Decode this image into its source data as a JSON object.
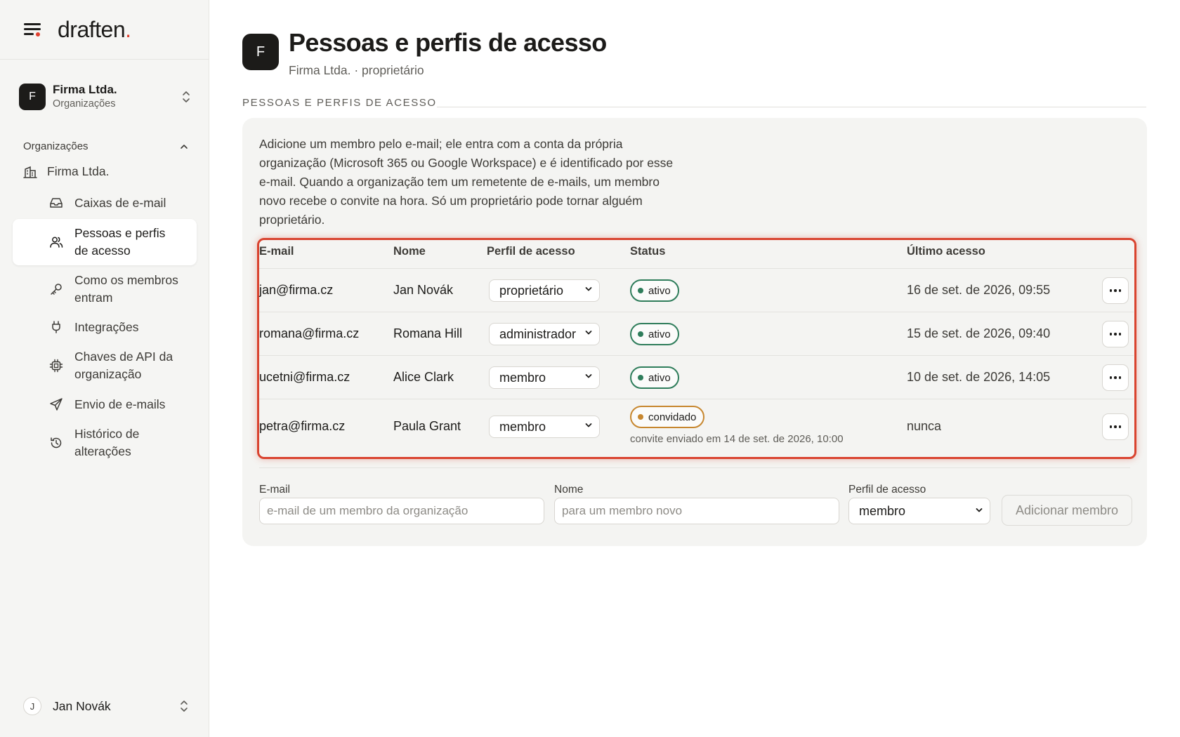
{
  "brand": {
    "name": "draften",
    "dot": "."
  },
  "org_switcher": {
    "initial": "F",
    "name": "Firma Ltda.",
    "sub": "Organizações"
  },
  "sidebar": {
    "section_title": "Organizações",
    "org_item": "Firma Ltda.",
    "items": [
      {
        "label": "Caixas de e-mail",
        "icon": "inbox-icon"
      },
      {
        "label": "Pessoas e perfis de acesso",
        "icon": "users-icon",
        "active": true
      },
      {
        "label": "Como os membros entram",
        "icon": "key-icon"
      },
      {
        "label": "Integrações",
        "icon": "plug-icon"
      },
      {
        "label": "Chaves de API da organização",
        "icon": "chip-icon"
      },
      {
        "label": "Envio de e-mails",
        "icon": "send-icon"
      },
      {
        "label": "Histórico de alterações",
        "icon": "history-icon"
      }
    ]
  },
  "user": {
    "initial": "J",
    "name": "Jan Novák"
  },
  "page": {
    "avatar_initial": "F",
    "title": "Pessoas e perfis de acesso",
    "subtitle": "Firma Ltda. · proprietário",
    "section_label": "PESSOAS E PERFIS DE ACESSO",
    "intro": "Adicione um membro pelo e-mail; ele entra com a conta da própria organização (Microsoft 365 ou Google Workspace) e é identificado por esse e-mail. Quando a organização tem um remetente de e-mails, um membro novo recebe o convite na hora. Só um proprietário pode tornar alguém proprietário."
  },
  "table": {
    "headers": {
      "email": "E-mail",
      "name": "Nome",
      "role": "Perfil de acesso",
      "status": "Status",
      "last": "Último acesso"
    },
    "rows": [
      {
        "email": "jan@firma.cz",
        "name": "Jan Novák",
        "role": "proprietário",
        "status": "ativo",
        "status_kind": "active",
        "last": "16 de set. de 2026, 09:55"
      },
      {
        "email": "romana@firma.cz",
        "name": "Romana Hill",
        "role": "administrador",
        "status": "ativo",
        "status_kind": "active",
        "last": "15 de set. de 2026, 09:40"
      },
      {
        "email": "ucetni@firma.cz",
        "name": "Alice Clark",
        "role": "membro",
        "status": "ativo",
        "status_kind": "active",
        "last": "10 de set. de 2026, 14:05"
      },
      {
        "email": "petra@firma.cz",
        "name": "Paula Grant",
        "role": "membro",
        "status": "convidado",
        "status_kind": "invited",
        "note": "convite enviado em 14 de set. de 2026, 10:00",
        "last": "nunca"
      }
    ]
  },
  "add_form": {
    "email_label": "E-mail",
    "email_placeholder": "e-mail de um membro da organização",
    "name_label": "Nome",
    "name_placeholder": "para um membro novo",
    "role_label": "Perfil de acesso",
    "role_value": "membro",
    "submit": "Adicionar membro"
  },
  "colors": {
    "accent": "#e0402f",
    "active_status": "#2f7d5b",
    "invited_status": "#c7872f",
    "highlight": "#d9432f"
  }
}
